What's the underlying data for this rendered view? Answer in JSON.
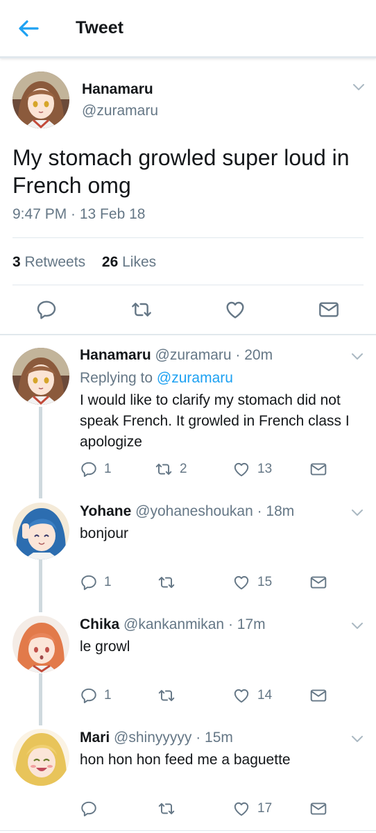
{
  "header": {
    "title": "Tweet"
  },
  "main_tweet": {
    "name": "Hanamaru",
    "handle": "@zuramaru",
    "text": "My stomach growled super loud in French omg",
    "timestamp": "9:47 PM · 13 Feb 18",
    "retweets": "3",
    "retweets_label": "Retweets",
    "likes": "26",
    "likes_label": "Likes"
  },
  "replies": [
    {
      "name": "Hanamaru",
      "handle": "@zuramaru",
      "time": "· 20m",
      "replying_prefix": "Replying to ",
      "replying_to": "@zuramaru",
      "text": "I would like to clarify my stomach did not speak French. It growled in French class I apologize",
      "replies": "1",
      "retweets": "2",
      "likes": "13"
    },
    {
      "name": "Yohane",
      "handle": "@yohaneshoukan",
      "time": "· 18m",
      "text": "bonjour",
      "replies": "1",
      "retweets": "",
      "likes": "15"
    },
    {
      "name": "Chika",
      "handle": "@kankanmikan",
      "time": "· 17m",
      "text": "le growl",
      "replies": "1",
      "retweets": "",
      "likes": "14"
    },
    {
      "name": "Mari",
      "handle": "@shinyyyyy",
      "time": "· 15m",
      "text": "hon hon hon feed me a baguette",
      "replies": "",
      "retweets": "",
      "likes": "17"
    }
  ],
  "colors": {
    "accent": "#1da1f2",
    "text": "#14171a",
    "secondary": "#657786",
    "divider": "#e1e8ed"
  }
}
